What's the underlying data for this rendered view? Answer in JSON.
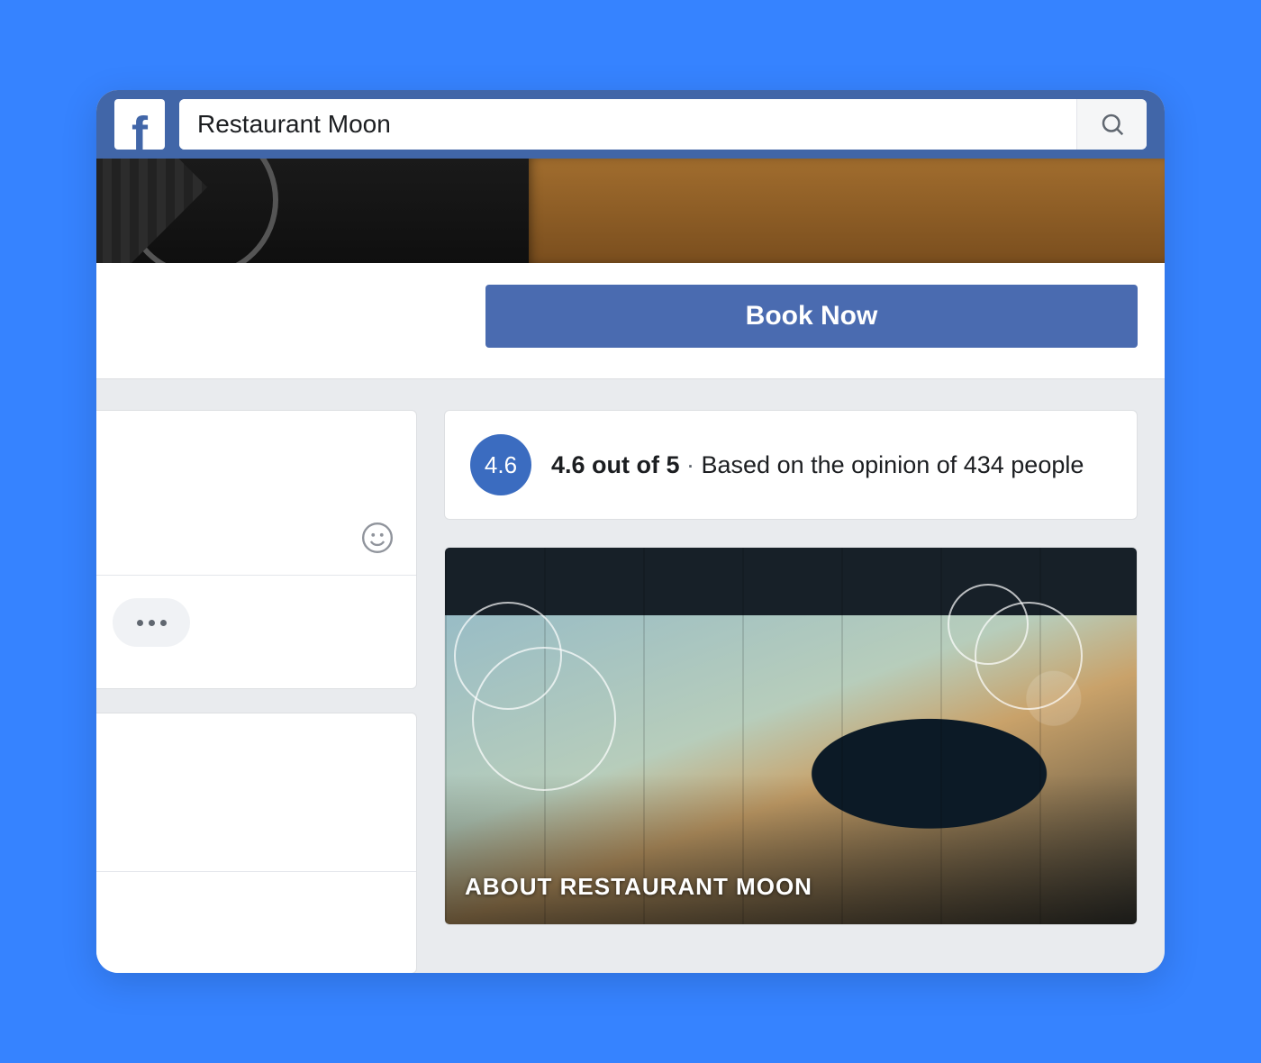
{
  "topbar": {
    "search_value": "Restaurant Moon"
  },
  "action": {
    "book_now_label": "Book Now"
  },
  "rating": {
    "badge": "4.6",
    "score_text": "4.6 out of 5",
    "separator": " · ",
    "basis_text": "Based on the opinion of 434 people"
  },
  "about": {
    "label": "ABOUT RESTAURANT MOON"
  }
}
